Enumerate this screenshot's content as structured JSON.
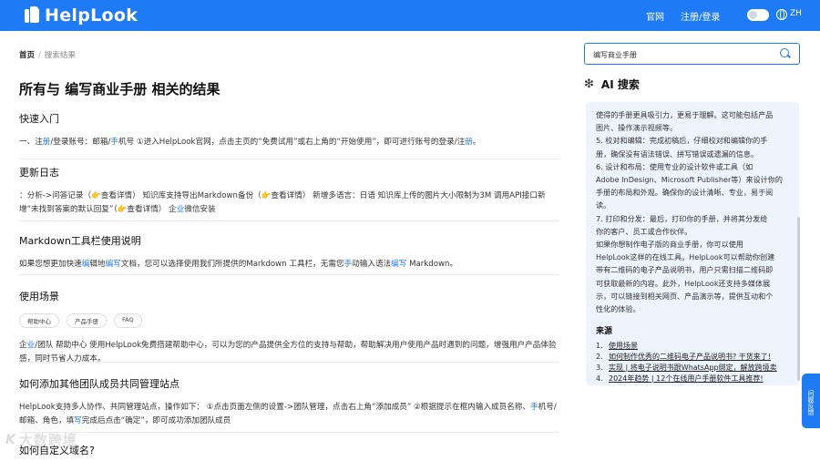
{
  "header": {
    "logo_text": "HelpLook",
    "nav": [
      "官网",
      "注册/登录"
    ],
    "lang": "ZH",
    "brand_color": "#1f7bf5"
  },
  "breadcrumb": {
    "home": "首页",
    "sep": "/",
    "current": "搜索结果"
  },
  "page_title": "所有与 编写商业手册 相关的结果",
  "results": [
    {
      "title": "快速入门",
      "body": [
        {
          "t": "一、注"
        },
        {
          "t": "册",
          "h": 1
        },
        {
          "t": "/登录账号：邮箱/"
        },
        {
          "t": "手",
          "h": 1
        },
        {
          "t": "机号 ①进入HelpLook官网，点击主页的“免费试用”或右上角的“开始使用”，即可进行账号的登录/注"
        },
        {
          "t": "册",
          "h": 1
        },
        {
          "t": "。"
        }
      ]
    },
    {
      "title": "更新日志",
      "body": [
        {
          "t": "：分析->问答记录（👉查看详情） 知识库支持导出Markdown备份（👉查看详情） 新增多语言：日语 知识库上传的图片大小限制为3M 调用API接口新增“未找到答案的默认回复”（👉查看详情） 企"
        },
        {
          "t": "业",
          "h": 1
        },
        {
          "t": "微信安装"
        }
      ]
    },
    {
      "title": "Markdown工具栏使用说明",
      "body": [
        {
          "t": "如果您想更加快速"
        },
        {
          "t": "编",
          "h": 1
        },
        {
          "t": "辑地"
        },
        {
          "t": "编写",
          "h": 1
        },
        {
          "t": "文档，您可以选择使用我们所提供的Markdown 工具栏，无需您"
        },
        {
          "t": "手",
          "h": 1
        },
        {
          "t": "动输入语法"
        },
        {
          "t": "编写",
          "h": 1
        },
        {
          "t": " Markdown。"
        }
      ]
    },
    {
      "title": "使用场景",
      "tags": [
        "帮助中心",
        "产品手册",
        "FAQ"
      ],
      "body": [
        {
          "t": "企"
        },
        {
          "t": "业",
          "h": 1
        },
        {
          "t": "/团队 帮助中心 使用HelpLook免费搭建帮助中心，可以为您的产品提供全方位的支持与帮助，帮助解决用户使用产品时遇到的问题，增强用户产品体验感，同时节省人力成本。"
        }
      ]
    },
    {
      "title": "如何添加其他团队成员共同管理站点",
      "body": [
        {
          "t": "HelpLook支持多人协作、共同管理站点，操作如下： ①点击页面左侧的设置->团队管理，点击右上角“添加成员” ②根据提示在框内输入成员名称、"
        },
        {
          "t": "手",
          "h": 1
        },
        {
          "t": "机号/邮箱、角色，填"
        },
        {
          "t": "写",
          "h": 1
        },
        {
          "t": "完成后点击“确定”，即可成功添加团队成员"
        }
      ]
    },
    {
      "title": "如何自定义域名?"
    }
  ],
  "search": {
    "value": "编写商业手册"
  },
  "ai": {
    "title": "AI 搜索",
    "lines": [
      "使得的手册更具吸引力，更易于理解。这可能包括产品",
      "图片、操作演示视频等。",
      "5. 校对和编辑：完成初稿后，仔细校对和编辑你的手",
      "册，确保没有语法错误、拼写错误或遗漏的信息。",
      "6. 设计和布局：使用专业的设计软件或工具（如",
      "Adobe InDesign、Microsoft Publisher等）来设计你的",
      "手册的布局和外观。确保你的设计清晰、专业，易于阅",
      "读。",
      "7. 打印和分发：最后，打印你的手册，并将其分发给",
      "你的客户、员工或合作伙伴。",
      "如果你想制作电子版的商业手册，你可以使用",
      "HelpLook这样的在线工具。HelpLook可以帮助你创建",
      "带有二维码的电子产品说明书，用户只需扫描二维码即",
      "可获取最新的内容。此外，HelpLook还支持多媒体展",
      "示，可以链接到相关网页、产品演示等，提供互动和个",
      "性化的体验。"
    ],
    "sources_title": "来源",
    "sources": [
      {
        "n": "1.",
        "label": "使用场景"
      },
      {
        "n": "2.",
        "label": "如何制作优秀的二维码电子产品说明书? 干货来了!"
      },
      {
        "n": "3.",
        "label": "实现 | 将电子说明书跟WhatsApp绑定，解放跨境卖"
      },
      {
        "n": "4.",
        "label": "2024年趋势 | 12个在线用户手册软件工具推荐!"
      }
    ]
  },
  "feedback_label": "问题反馈",
  "watermark": {
    "mark": "K",
    "text": "大数跨境"
  }
}
